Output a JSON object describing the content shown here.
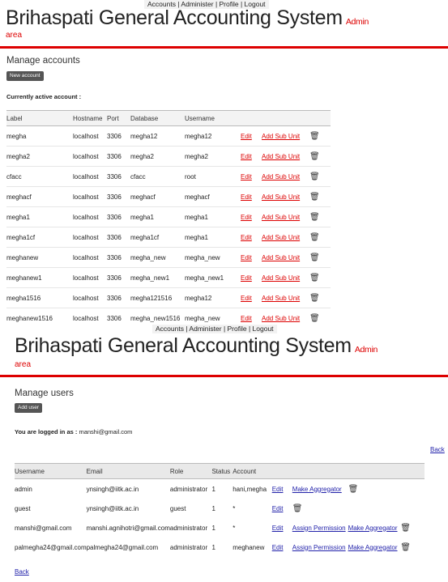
{
  "topnav": "Accounts | Administer | Profile | Logout",
  "app": {
    "title": "Brihaspati General Accounting System",
    "admin": "Admin",
    "area": "area"
  },
  "accounts": {
    "heading": "Manage accounts",
    "new_button": "New account",
    "active_label": "Currently active account :",
    "columns": [
      "Label",
      "Hostname",
      "Port",
      "Database",
      "Username"
    ],
    "edit_label": "Edit",
    "addsub_label": "Add Sub Unit",
    "rows": [
      {
        "label": "megha",
        "hostname": "localhost",
        "port": "3306",
        "database": "megha12",
        "username": "megha12"
      },
      {
        "label": "megha2",
        "hostname": "localhost",
        "port": "3306",
        "database": "megha2",
        "username": "megha2"
      },
      {
        "label": "cfacc",
        "hostname": "localhost",
        "port": "3306",
        "database": "cfacc",
        "username": "root"
      },
      {
        "label": "meghacf",
        "hostname": "localhost",
        "port": "3306",
        "database": "meghacf",
        "username": "meghacf"
      },
      {
        "label": "megha1",
        "hostname": "localhost",
        "port": "3306",
        "database": "megha1",
        "username": "megha1"
      },
      {
        "label": "megha1cf",
        "hostname": "localhost",
        "port": "3306",
        "database": "megha1cf",
        "username": "megha1"
      },
      {
        "label": "meghanew",
        "hostname": "localhost",
        "port": "3306",
        "database": "megha_new",
        "username": "megha_new"
      },
      {
        "label": "meghanew1",
        "hostname": "localhost",
        "port": "3306",
        "database": "megha_new1",
        "username": "megha_new1"
      },
      {
        "label": "megha1516",
        "hostname": "localhost",
        "port": "3306",
        "database": "megha121516",
        "username": "megha12"
      },
      {
        "label": "meghanew1516",
        "hostname": "localhost",
        "port": "3306",
        "database": "megha_new1516",
        "username": "megha_new"
      }
    ]
  },
  "users": {
    "heading": "Manage users",
    "add_button": "Add user",
    "logged_label": "You are logged in as :",
    "logged_value": "manshi@gmail.com",
    "back_label": "Back",
    "columns": [
      "Username",
      "Email",
      "Role",
      "Status",
      "Account"
    ],
    "edit_label": "Edit",
    "rows": [
      {
        "username": "admin",
        "email": "ynsingh@iitk.ac.in",
        "role": "administrator",
        "status": "1",
        "account": "hani,megha",
        "action1": "Make Aggregator",
        "action2": ""
      },
      {
        "username": "guest",
        "email": "ynsingh@iitk.ac.in",
        "role": "guest",
        "status": "1",
        "account": "*",
        "action1": "",
        "action2": ""
      },
      {
        "username": "manshi@gmail.com",
        "email": "manshi.agnihotri@gmail.com",
        "role": "administrator",
        "status": "1",
        "account": "*",
        "action1": "Assign Permission",
        "action2": "Make Aggregator"
      },
      {
        "username": "palmegha24@gmail.com",
        "email": "palmegha24@gmail.com",
        "role": "administrator",
        "status": "1",
        "account": "meghanew",
        "action1": "Assign Permission",
        "action2": "Make Aggregator"
      }
    ]
  }
}
